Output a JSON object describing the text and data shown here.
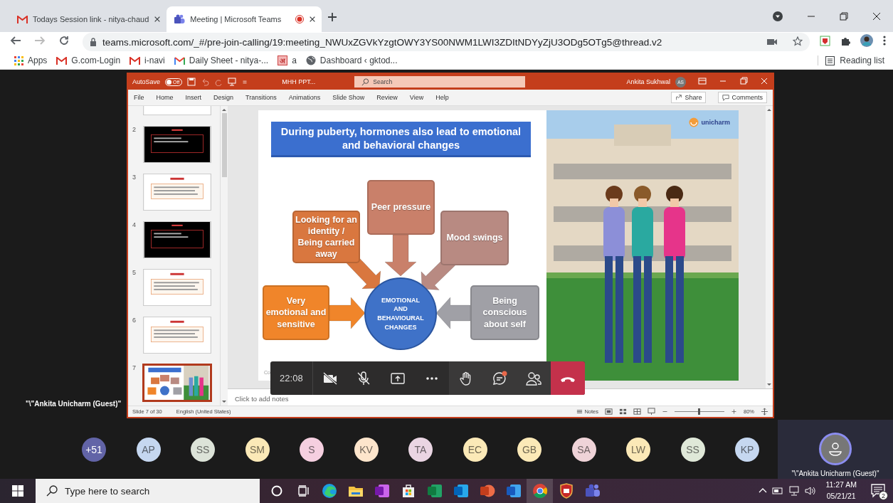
{
  "browser": {
    "tabs": [
      {
        "title": "Todays Session link - nitya-chaud",
        "selected": false,
        "kind": "gmail",
        "recording": false
      },
      {
        "title": "Meeting | Microsoft Teams",
        "selected": true,
        "kind": "teams",
        "recording": true
      }
    ],
    "address": "teams.microsoft.com/_#/pre-join-calling/19:meeting_NWUxZGVkYzgtOWY3YS00NWM1LWI3ZDItNDYyZjU3ODg5OTg5@thread.v2",
    "bookmarks": [
      {
        "label": "Apps",
        "kind": "apps"
      },
      {
        "label": "G.com-Login",
        "kind": "gmail"
      },
      {
        "label": "i-navi",
        "kind": "gmail"
      },
      {
        "label": "Daily Sheet - nitya-...",
        "kind": "gmail-color"
      },
      {
        "label": "a",
        "kind": "letter",
        "icon_text": "अ"
      },
      {
        "label": "Dashboard ‹ gktod...",
        "kind": "globe"
      }
    ],
    "reading_list": "Reading list"
  },
  "powerpoint": {
    "autosave": {
      "label": "AutoSave",
      "on": false,
      "state_text": "Off"
    },
    "file_name": "MHH PPT...",
    "search_placeholder": "Search",
    "user": "Ankita Sukhwal",
    "user_initials": "AS",
    "ribbon_tabs": [
      "File",
      "Home",
      "Insert",
      "Design",
      "Transitions",
      "Animations",
      "Slide Show",
      "Review",
      "View",
      "Help"
    ],
    "share": "Share",
    "comments": "Comments",
    "thumbnails": [
      {
        "kind": "title",
        "selected": false
      },
      {
        "number": "2",
        "kind": "dark",
        "selected": false
      },
      {
        "number": "3",
        "kind": "text",
        "selected": false
      },
      {
        "number": "4",
        "kind": "dark",
        "selected": false
      },
      {
        "number": "5",
        "kind": "text",
        "selected": false
      },
      {
        "number": "6",
        "kind": "text",
        "selected": false
      },
      {
        "number": "7",
        "kind": "diagram",
        "selected": true
      }
    ],
    "slide": {
      "title": "During puberty, hormones also lead to emotional and behavioral changes",
      "center": "EMOTIONAL AND BEHAVIOURAL CHANGES",
      "boxes": [
        {
          "text": "Peer pressure",
          "color": "#c9806a"
        },
        {
          "text": "Looking for an identity / Being carried away",
          "color": "#d9773f"
        },
        {
          "text": "Mood swings",
          "color": "#b88a82"
        },
        {
          "text": "Very emotional and sensitive",
          "color": "#f0852a"
        },
        {
          "text": "Being conscious about self",
          "color": "#a0a0a6"
        }
      ],
      "footer": "Co",
      "logo": "unicharm"
    },
    "notes_placeholder": "Click to add notes",
    "status": {
      "slide": "Slide 7 of 30",
      "language": "English (United States)",
      "notes": "Notes",
      "zoom": {
        "level": 0.5
      },
      "zoom_text": "80%"
    }
  },
  "meeting": {
    "presenter_label": "\"\\\"Ankita Unicharm (Guest)\"",
    "time": "22:08",
    "chat_unread": true,
    "participants": [
      {
        "initials": "+51",
        "color": "#6264a7"
      },
      {
        "initials": "AP",
        "color": "#c5d7f0"
      },
      {
        "initials": "SS",
        "color": "#dce3d8"
      },
      {
        "initials": "SM",
        "color": "#fbe9b7"
      },
      {
        "initials": "S",
        "color": "#f5cfe0"
      },
      {
        "initials": "KV",
        "color": "#fde5cc"
      },
      {
        "initials": "TA",
        "color": "#ead5e3"
      },
      {
        "initials": "EC",
        "color": "#fbe9b7"
      },
      {
        "initials": "GB",
        "color": "#fbe9b7"
      },
      {
        "initials": "SA",
        "color": "#efd3d8"
      },
      {
        "initials": "LW",
        "color": "#fbe9b7"
      },
      {
        "initials": "SS",
        "color": "#dfe8d8"
      },
      {
        "initials": "KP",
        "color": "#c5d7f0"
      }
    ],
    "self": {
      "name": "\"\\\"Ankita Unicharm (Guest)\""
    }
  },
  "taskbar": {
    "search_placeholder": "Type here to search",
    "apps": [
      {
        "kind": "cortana",
        "active": false
      },
      {
        "kind": "taskview",
        "active": false
      },
      {
        "kind": "edge",
        "active": false
      },
      {
        "kind": "explorer",
        "active": false
      },
      {
        "kind": "onenote",
        "active": false
      },
      {
        "kind": "store",
        "active": false
      },
      {
        "kind": "excel",
        "active": false
      },
      {
        "kind": "outlook",
        "active": false
      },
      {
        "kind": "powerpoint",
        "active": false
      },
      {
        "kind": "word",
        "active": false
      },
      {
        "kind": "chrome",
        "active": true
      },
      {
        "kind": "shield",
        "active": false
      },
      {
        "kind": "teams",
        "active": false
      }
    ],
    "time": "11:27 AM",
    "date": "05/21/21",
    "notifications": "2"
  }
}
